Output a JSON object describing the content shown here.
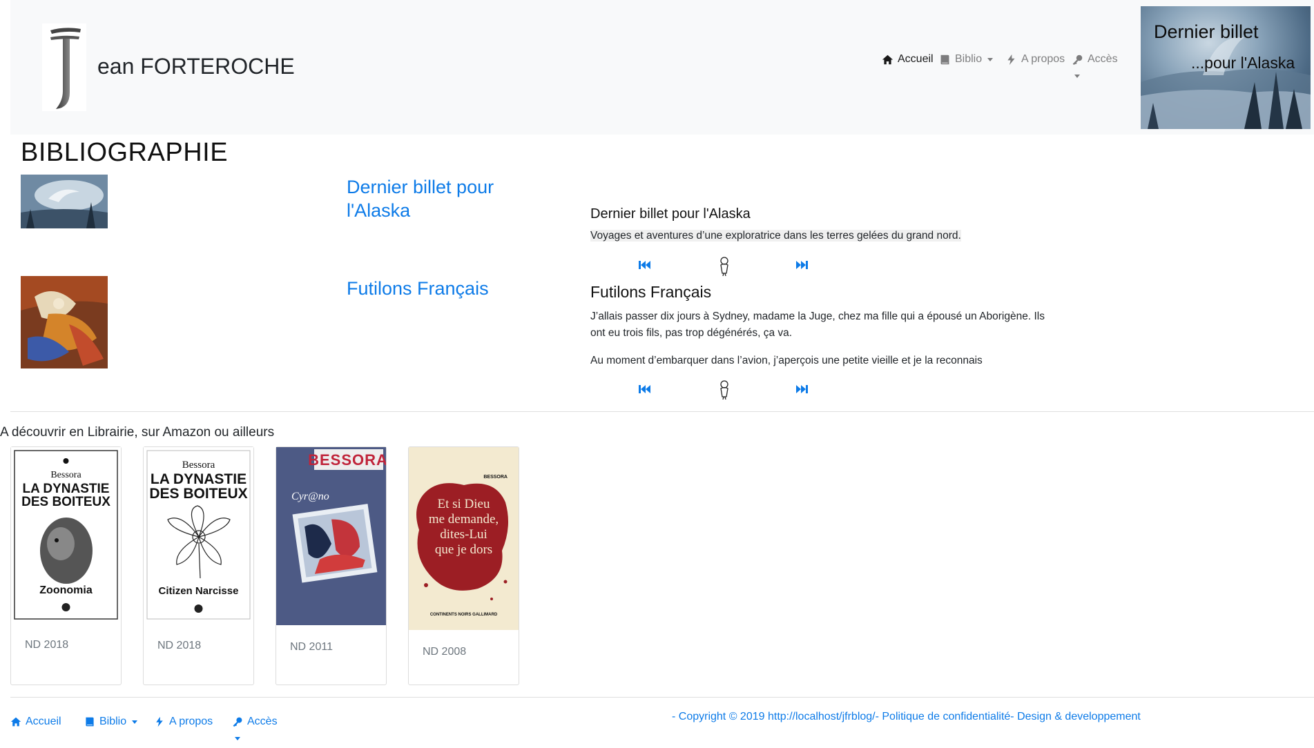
{
  "header": {
    "site_title": "ean FORTEROCHE",
    "nav": {
      "home": "Accueil",
      "biblio": "Biblio",
      "about": "A propos",
      "access": "Accès"
    },
    "banner": {
      "title": "Dernier billet",
      "subtitle": "...pour l'Alaska"
    }
  },
  "main": {
    "page_title": "BIBLIOGRAPHIE",
    "books": [
      {
        "link": "Dernier billet pour l'Alaska",
        "excerpt_title": "Dernier billet pour l'Alaska",
        "excerpt": [
          "Voyages et aventures d’une exploratrice dans les terres gelées du grand nord."
        ]
      },
      {
        "link": "Futilons Français",
        "excerpt_title": "Futilons Français",
        "excerpt": [
          "J’allais passer dix jours à Sydney, madame la Juge, chez ma fille qui a épousé un Aborigène. Ils ont eu trois fils, pas trop dégénérés, ça va.",
          "Au moment d’embarquer dans l’avion, j’aperçois une petite vieille et je la reconnais"
        ]
      }
    ]
  },
  "discover": {
    "heading": "A découvrir en Librairie, sur Amazon ou ailleurs",
    "cards": [
      {
        "date": "ND 2018",
        "cover": {
          "author": "Bessora",
          "title1": "LA DYNASTIE",
          "title2": "DES BOITEUX",
          "subtitle": "Zoonomia"
        }
      },
      {
        "date": "ND 2018",
        "cover": {
          "author": "Bessora",
          "title1": "LA DYNASTIE",
          "title2": "DES BOITEUX",
          "subtitle": "Citizen Narcisse"
        }
      },
      {
        "date": "ND 2011",
        "cover": {
          "author": "BESSORA",
          "title1": "Cyr@no"
        }
      },
      {
        "date": "ND 2008",
        "cover": {
          "author": "BESSORA",
          "title1": "Et si Dieu",
          "title2": "me demande,",
          "title3": "dites-Lui",
          "title4": "que je dors",
          "publisher": "CONTINENTS NOIRS  GALLIMARD"
        }
      }
    ]
  },
  "footer": {
    "nav": {
      "home": "Accueil",
      "biblio": "Biblio",
      "about": "A propos",
      "access": "Accès"
    },
    "copyright": "- Copyright © 2019 http://localhost/jfrblog/- Politique de confidentialité- Design & developpement"
  },
  "colors": {
    "link": "#0d7be8",
    "header_bg": "#f8f9fa"
  }
}
